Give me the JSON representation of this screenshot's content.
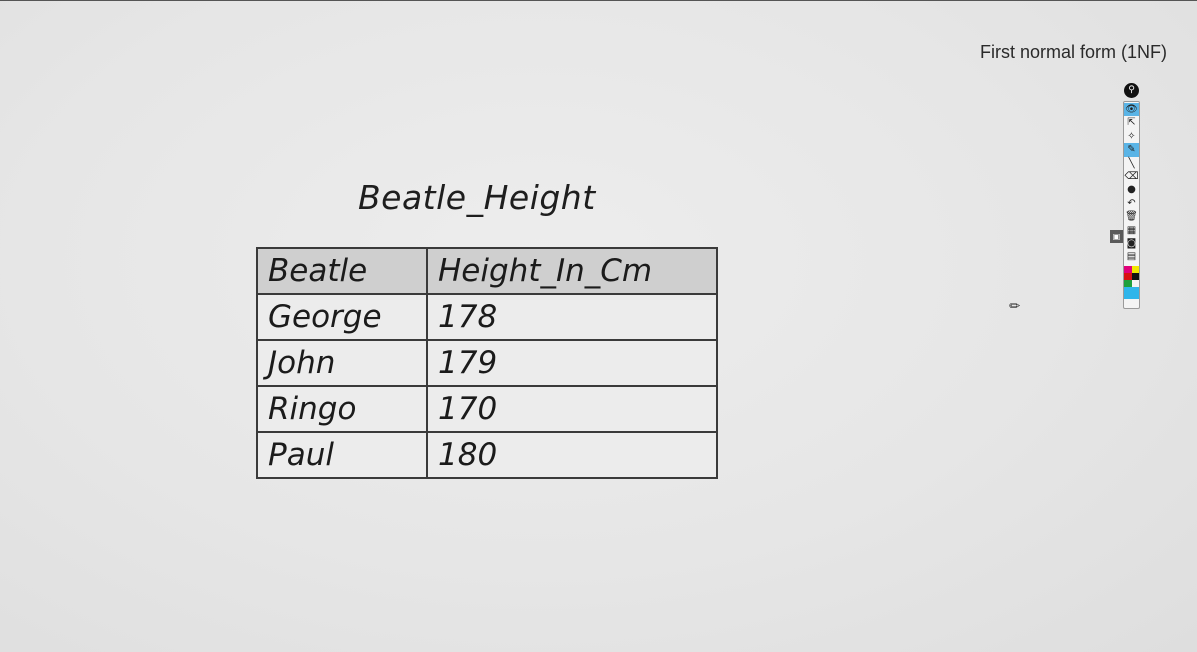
{
  "video": {
    "title": "First normal form (1NF)"
  },
  "sheet": {
    "title": "Beatle_Height",
    "columns": [
      "Beatle",
      "Height_In_Cm"
    ],
    "rows": [
      [
        "George",
        "178"
      ],
      [
        "John",
        "179"
      ],
      [
        "Ringo",
        "170"
      ],
      [
        "Paul",
        "180"
      ]
    ]
  },
  "toolbar": {
    "pin_icon": "pin-icon",
    "tools": [
      {
        "icon": "eye-icon",
        "glyph": "👁",
        "active": true
      },
      {
        "icon": "select-arrow-icon",
        "glyph": "⇱",
        "active": false
      },
      {
        "icon": "laser-pointer-icon",
        "glyph": "✧",
        "active": false
      },
      {
        "icon": "pen-icon",
        "glyph": "✎",
        "active": true
      },
      {
        "icon": "line-icon",
        "glyph": "╲",
        "active": false
      },
      {
        "icon": "eraser-icon",
        "glyph": "⌫",
        "active": false
      },
      {
        "icon": "dot-icon",
        "glyph": "●",
        "active": false
      },
      {
        "icon": "undo-icon",
        "glyph": "↶",
        "active": false
      },
      {
        "icon": "trash-icon",
        "glyph": "🗑",
        "active": false
      },
      {
        "icon": "whiteboard-icon",
        "glyph": "▦",
        "active": false
      },
      {
        "icon": "camera-icon",
        "glyph": "◙",
        "active": false
      },
      {
        "icon": "clipboard-icon",
        "glyph": "▤",
        "active": false
      }
    ],
    "palette": [
      "#e0007a",
      "#f2e600",
      "#d81010",
      "#111111",
      "#1ea03c",
      "#2fb5ea"
    ],
    "side_tab_icon": "screen-icon"
  },
  "cursor": {
    "icon": "pencil-cursor-icon"
  }
}
